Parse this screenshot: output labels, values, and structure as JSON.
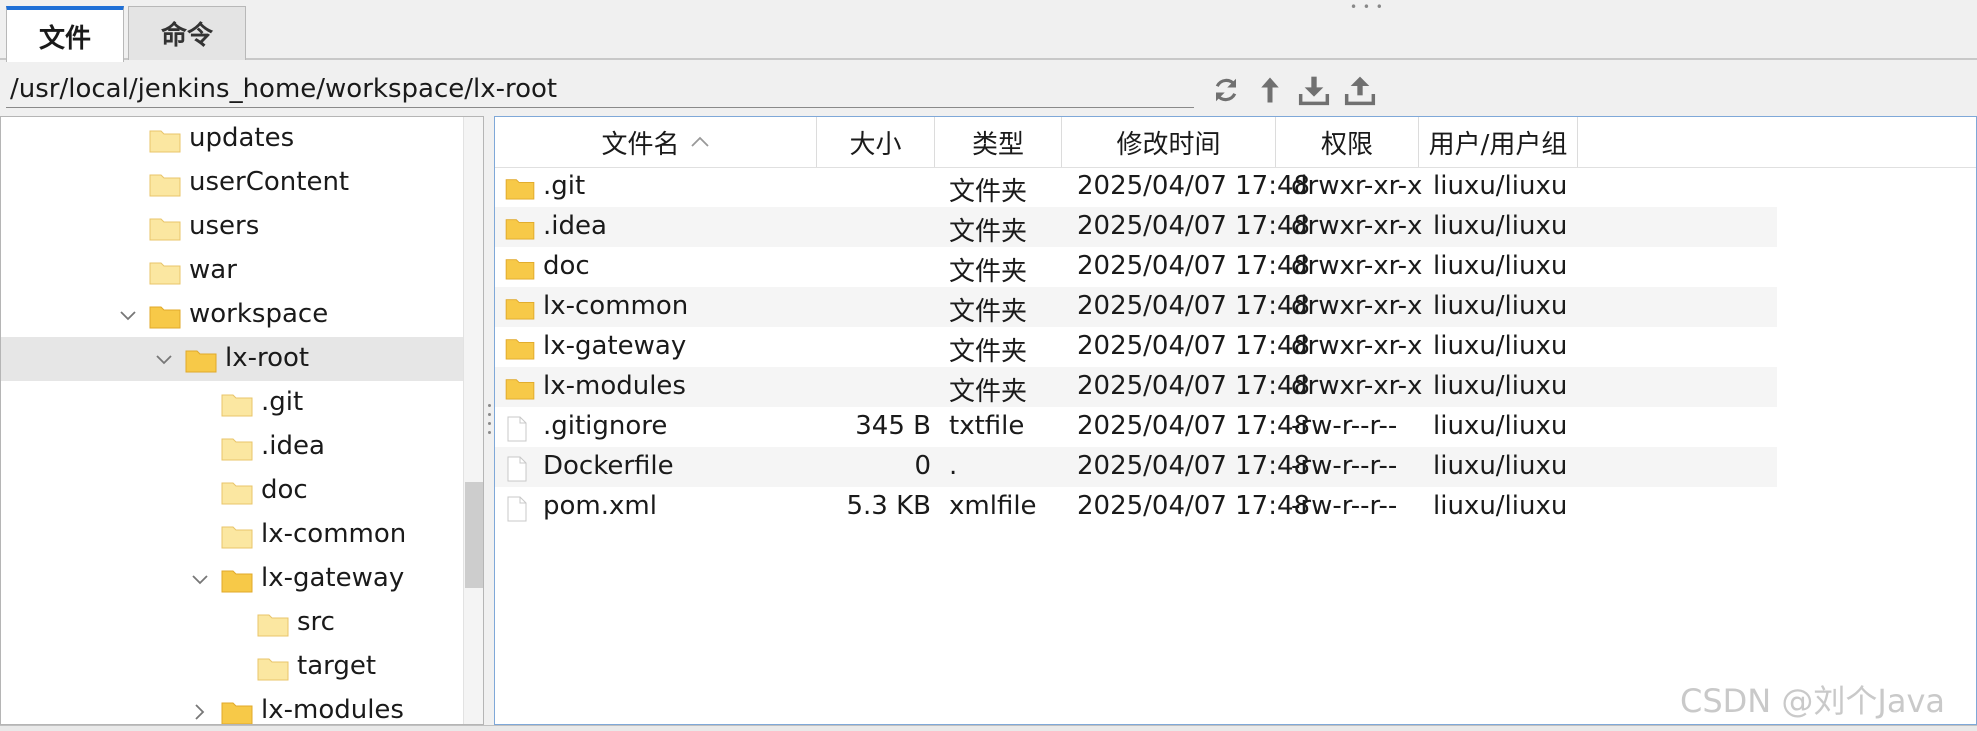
{
  "tabs": [
    {
      "label": "文件",
      "active": true
    },
    {
      "label": "命令",
      "active": false
    }
  ],
  "path": {
    "value": "/usr/local/jenkins_home/workspace/lx-root"
  },
  "toolbar": {
    "buttons": [
      {
        "icon": "refresh-icon"
      },
      {
        "icon": "up-folder-icon"
      },
      {
        "icon": "download-icon"
      },
      {
        "icon": "upload-icon"
      }
    ]
  },
  "tree": {
    "items": [
      {
        "label": "updates",
        "expander": "none"
      },
      {
        "label": "userContent",
        "expander": "none"
      },
      {
        "label": "users",
        "expander": "none"
      },
      {
        "label": "war",
        "expander": "none"
      },
      {
        "label": "workspace",
        "expander": "expanded"
      },
      {
        "label": "lx-root",
        "expander": "expanded",
        "selected": true
      },
      {
        "label": ".git",
        "expander": "none"
      },
      {
        "label": ".idea",
        "expander": "none"
      },
      {
        "label": "doc",
        "expander": "none"
      },
      {
        "label": "lx-common",
        "expander": "none"
      },
      {
        "label": "lx-gateway",
        "expander": "expanded"
      },
      {
        "label": "src",
        "expander": "none"
      },
      {
        "label": "target",
        "expander": "none"
      },
      {
        "label": "lx-modules",
        "expander": "collapsed"
      }
    ]
  },
  "files": {
    "columns": [
      "文件名",
      "大小",
      "类型",
      "修改时间",
      "权限",
      "用户/用户组"
    ],
    "rows": [
      {
        "name": ".git",
        "kind": "folder",
        "size": "",
        "type": "文件夹",
        "modified": "2025/04/07 17:48",
        "perm": "drwxr-xr-x",
        "owner": "liuxu/liuxu"
      },
      {
        "name": ".idea",
        "kind": "folder",
        "size": "",
        "type": "文件夹",
        "modified": "2025/04/07 17:48",
        "perm": "drwxr-xr-x",
        "owner": "liuxu/liuxu"
      },
      {
        "name": "doc",
        "kind": "folder",
        "size": "",
        "type": "文件夹",
        "modified": "2025/04/07 17:48",
        "perm": "drwxr-xr-x",
        "owner": "liuxu/liuxu"
      },
      {
        "name": "lx-common",
        "kind": "folder",
        "size": "",
        "type": "文件夹",
        "modified": "2025/04/07 17:48",
        "perm": "drwxr-xr-x",
        "owner": "liuxu/liuxu"
      },
      {
        "name": "lx-gateway",
        "kind": "folder",
        "size": "",
        "type": "文件夹",
        "modified": "2025/04/07 17:48",
        "perm": "drwxr-xr-x",
        "owner": "liuxu/liuxu"
      },
      {
        "name": "lx-modules",
        "kind": "folder",
        "size": "",
        "type": "文件夹",
        "modified": "2025/04/07 17:48",
        "perm": "drwxr-xr-x",
        "owner": "liuxu/liuxu"
      },
      {
        "name": ".gitignore",
        "kind": "file",
        "size": "345 B",
        "type": "txtfile",
        "modified": "2025/04/07 17:48",
        "perm": "-rw-r--r--",
        "owner": "liuxu/liuxu"
      },
      {
        "name": "Dockerfile",
        "kind": "file",
        "size": "0",
        "type": ".",
        "modified": "2025/04/07 17:48",
        "perm": "-rw-r--r--",
        "owner": "liuxu/liuxu"
      },
      {
        "name": "pom.xml",
        "kind": "file",
        "size": "5.3 KB",
        "type": "xmlfile",
        "modified": "2025/04/07 17:48",
        "perm": "-rw-r--r--",
        "owner": "liuxu/liuxu"
      }
    ]
  },
  "watermark": "CSDN @刘个Java",
  "colors": {
    "accent": "#1e6fd6",
    "folder": "#f7c948",
    "folder_dark": "#e0a92a",
    "selected_row": "#e6e6e6"
  }
}
